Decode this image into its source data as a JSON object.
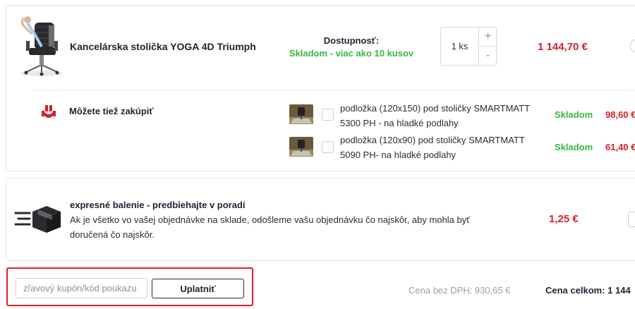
{
  "product": {
    "name": "Kancelárska stolička YOGA 4D Triumph",
    "availability_label": "Dostupnosť:",
    "availability_value": "Skladom - viac ako 10 kusov",
    "quantity": "1 ks",
    "qty_plus": "+",
    "qty_minus": "-",
    "price": "1 144,70 €"
  },
  "upsell": {
    "title": "Môžete tiež zakúpiť",
    "items": [
      {
        "name": "podložka (120x150) pod stoličky SMARTMATT 5300 PH - na hladké podlahy",
        "stock": "Skladom",
        "price": "98,60 €"
      },
      {
        "name": "podložka (120x90) pod stoličky SMARTMATT 5090 PH- na hladké podlahy",
        "stock": "Skladom",
        "price": "61,40 €"
      }
    ]
  },
  "express": {
    "title": "expresné balenie - predbiehajte v poradí",
    "description": "Ak je všetko vo vašej objednávke na sklade, odošleme vašu objednávku čo najskôr, aby mohla byť doručená čo najskôr.",
    "price": "1,25 €"
  },
  "coupon": {
    "placeholder": "zľavový kupón/kód poukazu",
    "apply_label": "Uplatniť"
  },
  "summary": {
    "price_without_vat": "Cena bez DPH: 930,65 €",
    "total": "Cena celkom: 1 144"
  },
  "colors": {
    "price_red": "#d51f26",
    "stock_green": "#3cb544",
    "highlight_red": "#e02020"
  },
  "icons": {
    "upsell": "gift-hands-icon",
    "express": "fast-box-icon"
  }
}
